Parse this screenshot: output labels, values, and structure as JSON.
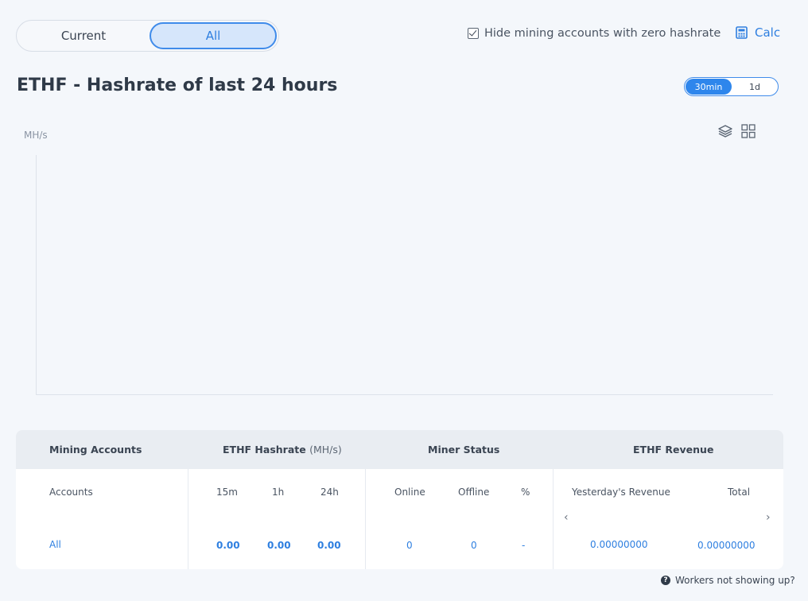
{
  "scope_toggle": {
    "current_label": "Current",
    "all_label": "All",
    "selected": "All"
  },
  "hide_zero": {
    "label": "Hide mining accounts with zero hashrate",
    "checked": true
  },
  "calc_label": "Calc",
  "chart_title": "ETHF - Hashrate of last 24 hours",
  "period_toggle": {
    "options": [
      "30min",
      "1d"
    ],
    "selected": "30min"
  },
  "chart_data": {
    "type": "line",
    "title": "ETHF - Hashrate of last 24 hours",
    "ylabel": "MH/s",
    "xlabel": "",
    "series": [],
    "x": []
  },
  "table": {
    "headers": {
      "accounts": "Mining Accounts",
      "hashrate": "ETHF Hashrate",
      "hashrate_unit": "(MH/s)",
      "status": "Miner Status",
      "revenue": "ETHF Revenue"
    },
    "subheaders": {
      "accounts": "Accounts",
      "h15m": "15m",
      "h1h": "1h",
      "h24h": "24h",
      "online": "Online",
      "offline": "Offline",
      "pct": "%",
      "yesterday": "Yesterday's Revenue",
      "total": "Total"
    },
    "row": {
      "account": "All",
      "h15m": "0.00",
      "h1h": "0.00",
      "h24h": "0.00",
      "online": "0",
      "offline": "0",
      "pct": "-",
      "yesterday": "0.00000000",
      "total": "0.00000000"
    }
  },
  "workers_help": "Workers not showing up?"
}
